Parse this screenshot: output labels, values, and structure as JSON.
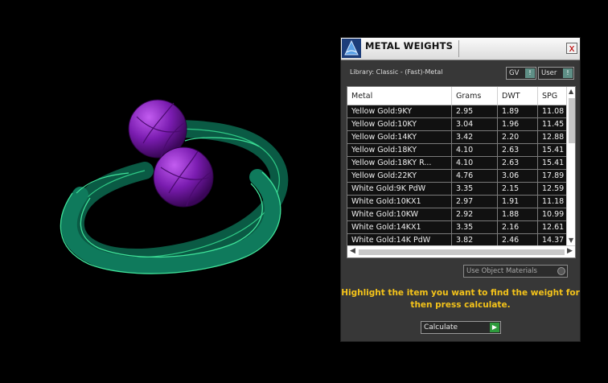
{
  "panel": {
    "title": "METAL WEIGHTS",
    "close_glyph": "x",
    "library_label": "Library: Classic - (Fast)-Metal",
    "gv_button": "GV",
    "user_button": "User",
    "knob_glyph": "!",
    "columns": [
      "Metal",
      "Grams",
      "DWT",
      "SPG"
    ],
    "rows": [
      [
        "Yellow Gold:9KY",
        "2.95",
        "1.89",
        "11.08"
      ],
      [
        "Yellow Gold:10KY",
        "3.04",
        "1.96",
        "11.45"
      ],
      [
        "Yellow Gold:14KY",
        "3.42",
        "2.20",
        "12.88"
      ],
      [
        "Yellow Gold:18KY",
        "4.10",
        "2.63",
        "15.41"
      ],
      [
        "Yellow Gold:18KY R...",
        "4.10",
        "2.63",
        "15.41"
      ],
      [
        "Yellow Gold:22KY",
        "4.76",
        "3.06",
        "17.89"
      ],
      [
        "White Gold:9K PdW",
        "3.35",
        "2.15",
        "12.59"
      ],
      [
        "White Gold:10KX1",
        "2.97",
        "1.91",
        "11.18"
      ],
      [
        "White Gold:10KW",
        "2.92",
        "1.88",
        "10.99"
      ],
      [
        "White Gold:14KX1",
        "3.35",
        "2.16",
        "12.61"
      ],
      [
        "White Gold:14K PdW",
        "3.82",
        "2.46",
        "14.37"
      ]
    ],
    "use_object_materials": "Use Object Materials",
    "message": "Highlight the item you want to find the weight for then press calculate.",
    "calculate_button": "Calculate",
    "calc_glyph": "▶"
  },
  "colors": {
    "ring_band": "#0f7a5c",
    "ring_edge": "#3fe39a",
    "ball": "#7a1cb0",
    "message_text": "#f4c31a",
    "accent_knob": "#5f8f86",
    "calc_knob": "#2d9a3c"
  },
  "icons": {
    "title_icon": "metal-weights-app-icon",
    "close_icon": "close-icon"
  }
}
